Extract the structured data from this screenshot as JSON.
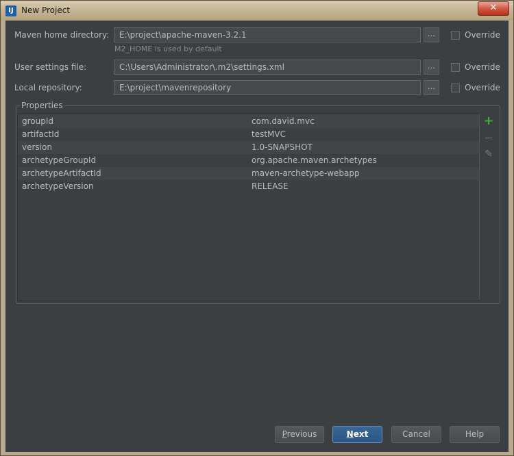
{
  "window": {
    "title": "New Project",
    "close_glyph": "✕",
    "icon": "intellij-app-icon"
  },
  "maven_home": {
    "label": "Maven home directory:",
    "value": "E:\\project\\apache-maven-3.2.1",
    "hint": "M2_HOME is used by default",
    "override_label": "Override",
    "browse": "…"
  },
  "user_settings": {
    "label": "User settings file:",
    "value": "C:\\Users\\Administrator\\.m2\\settings.xml",
    "override_label": "Override",
    "browse": "…"
  },
  "local_repo": {
    "label": "Local repository:",
    "value": "E:\\project\\mavenrepository",
    "override_label": "Override",
    "browse": "…"
  },
  "properties": {
    "title": "Properties",
    "rows": [
      {
        "key": "groupId",
        "value": "com.david.mvc"
      },
      {
        "key": "artifactId",
        "value": "testMVC"
      },
      {
        "key": "version",
        "value": "1.0-SNAPSHOT"
      },
      {
        "key": "archetypeGroupId",
        "value": "org.apache.maven.archetypes"
      },
      {
        "key": "archetypeArtifactId",
        "value": "maven-archetype-webapp"
      },
      {
        "key": "archetypeVersion",
        "value": "RELEASE"
      }
    ],
    "add_glyph": "+",
    "remove_glyph": "—",
    "edit_glyph": "✎",
    "colors": {
      "add": "#3fae3f",
      "disabled": "#7a7a7a"
    }
  },
  "buttons": {
    "previous": {
      "mnemonic": "P",
      "rest": "revious"
    },
    "next": {
      "mnemonic": "N",
      "rest": "ext"
    },
    "cancel": "Cancel",
    "help": "Help"
  }
}
